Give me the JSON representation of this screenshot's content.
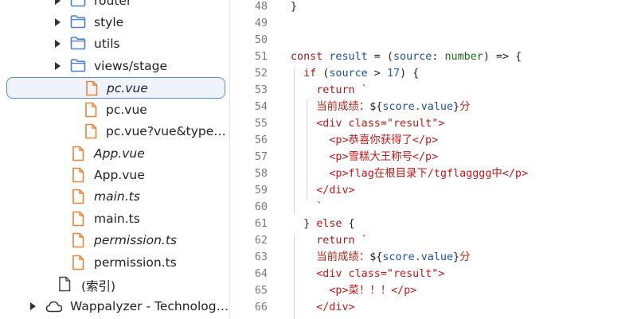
{
  "sidebar": {
    "items": [
      {
        "label": "router",
        "type": "folder",
        "arrow": true,
        "italic": false,
        "icon": "folder-icon"
      },
      {
        "label": "style",
        "type": "folder",
        "arrow": true,
        "italic": false,
        "icon": "folder-icon"
      },
      {
        "label": "utils",
        "type": "folder",
        "arrow": true,
        "italic": false,
        "icon": "folder-icon"
      },
      {
        "label": "views/stage",
        "type": "folder",
        "arrow": true,
        "italic": false,
        "icon": "folder-icon"
      },
      {
        "label": "pc.vue",
        "type": "file",
        "arrow": false,
        "italic": true,
        "icon": "file-icon",
        "selected": true
      },
      {
        "label": "pc.vue",
        "type": "file",
        "arrow": false,
        "italic": false,
        "icon": "file-icon"
      },
      {
        "label": "pc.vue?vue&type…",
        "type": "file",
        "arrow": false,
        "italic": false,
        "icon": "file-icon"
      },
      {
        "label": "App.vue",
        "type": "file",
        "arrow": false,
        "italic": true,
        "icon": "file-icon"
      },
      {
        "label": "App.vue",
        "type": "file",
        "arrow": false,
        "italic": false,
        "icon": "file-icon"
      },
      {
        "label": "main.ts",
        "type": "file",
        "arrow": false,
        "italic": true,
        "icon": "file-icon"
      },
      {
        "label": "main.ts",
        "type": "file",
        "arrow": false,
        "italic": false,
        "icon": "file-icon"
      },
      {
        "label": "permission.ts",
        "type": "file",
        "arrow": false,
        "italic": true,
        "icon": "file-icon"
      },
      {
        "label": "permission.ts",
        "type": "file",
        "arrow": false,
        "italic": false,
        "icon": "file-icon"
      },
      {
        "label": "(索引)",
        "type": "index",
        "arrow": false,
        "italic": false,
        "icon": "page-icon"
      },
      {
        "label": "Wappalyzer - Technolog…",
        "type": "extension",
        "arrow": true,
        "italic": false,
        "icon": "cloud-icon"
      }
    ]
  },
  "editor": {
    "lines": [
      {
        "num": "48",
        "tokens": [
          [
            "}",
            "default"
          ]
        ]
      },
      {
        "num": "49",
        "tokens": []
      },
      {
        "num": "50",
        "tokens": []
      },
      {
        "num": "51",
        "tokens": [
          [
            "const ",
            "kw"
          ],
          [
            "result",
            "var"
          ],
          [
            " = (",
            "default"
          ],
          [
            "source",
            "var"
          ],
          [
            ": ",
            "default"
          ],
          [
            "number",
            "type"
          ],
          [
            ") => {",
            "default"
          ]
        ]
      },
      {
        "num": "52",
        "tokens": [
          [
            "  if",
            "kw"
          ],
          [
            " (",
            "default"
          ],
          [
            "source",
            "var"
          ],
          [
            " > ",
            "default"
          ],
          [
            "17",
            "num"
          ],
          [
            ") {",
            "default"
          ]
        ]
      },
      {
        "num": "53",
        "tokens": [
          [
            "    return",
            "kw"
          ],
          [
            " `",
            "str"
          ]
        ]
      },
      {
        "num": "54",
        "tokens": [
          [
            "    当前成绩：",
            "cn"
          ],
          [
            "${",
            "default"
          ],
          [
            "score.value",
            "var"
          ],
          [
            "}",
            "default"
          ],
          [
            "分",
            "cn"
          ]
        ]
      },
      {
        "num": "55",
        "tokens": [
          [
            "    <div class=\"result\">",
            "tag"
          ]
        ]
      },
      {
        "num": "56",
        "tokens": [
          [
            "      <p>恭喜你获得了</p>",
            "tag"
          ]
        ]
      },
      {
        "num": "57",
        "tokens": [
          [
            "      <p>雪糕大王称号</p>",
            "tag"
          ]
        ]
      },
      {
        "num": "58",
        "tokens": [
          [
            "      <p>flag在根目录下/tgflagggg中</p>",
            "tag"
          ]
        ]
      },
      {
        "num": "59",
        "tokens": [
          [
            "    </div>",
            "tag"
          ]
        ]
      },
      {
        "num": "60",
        "tokens": [
          [
            "    `",
            "str"
          ]
        ]
      },
      {
        "num": "61",
        "tokens": [
          [
            "  } ",
            "default"
          ],
          [
            "else",
            "kw"
          ],
          [
            " {",
            "default"
          ]
        ]
      },
      {
        "num": "62",
        "tokens": [
          [
            "    return",
            "kw"
          ],
          [
            " `",
            "str"
          ]
        ]
      },
      {
        "num": "63",
        "tokens": [
          [
            "    当前成绩：",
            "cn"
          ],
          [
            "${",
            "default"
          ],
          [
            "score.value",
            "var"
          ],
          [
            "}",
            "default"
          ],
          [
            "分",
            "cn"
          ]
        ]
      },
      {
        "num": "64",
        "tokens": [
          [
            "    <div class=\"result\">",
            "tag"
          ]
        ]
      },
      {
        "num": "65",
        "tokens": [
          [
            "      <p>菜！！！</p>",
            "tag"
          ]
        ]
      },
      {
        "num": "66",
        "tokens": [
          [
            "    </div>",
            "tag"
          ]
        ]
      }
    ]
  },
  "colors": {
    "folder_icon": "#4a7fd1",
    "file_icon": "#e8843a",
    "selection_border": "#5b8bd9",
    "selection_bg": "#eef3fc"
  }
}
